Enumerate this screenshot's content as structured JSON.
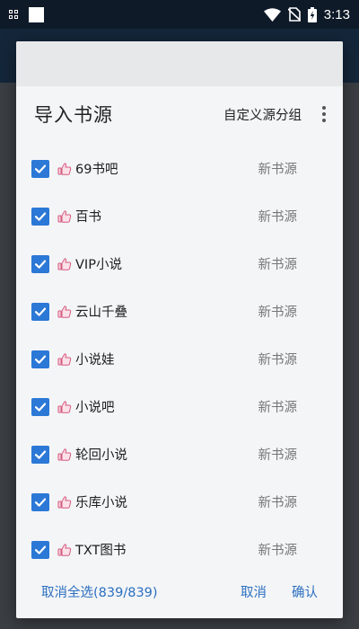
{
  "status_bar": {
    "time": "3:13"
  },
  "dialog": {
    "title": "导入书源",
    "header_action": "自定义源分组",
    "items": [
      {
        "name": "69书吧",
        "group": "新书源",
        "checked": true
      },
      {
        "name": "百书",
        "group": "新书源",
        "checked": true
      },
      {
        "name": "VIP小说",
        "group": "新书源",
        "checked": true
      },
      {
        "name": "云山千叠",
        "group": "新书源",
        "checked": true
      },
      {
        "name": "小说娃",
        "group": "新书源",
        "checked": true
      },
      {
        "name": "小说吧",
        "group": "新书源",
        "checked": true
      },
      {
        "name": "轮回小说",
        "group": "新书源",
        "checked": true
      },
      {
        "name": "乐库小说",
        "group": "新书源",
        "checked": true
      },
      {
        "name": "TXT图书",
        "group": "新书源",
        "checked": true
      }
    ],
    "footer": {
      "select_all": "取消全选(839/839)",
      "cancel": "取消",
      "confirm": "确认"
    }
  },
  "colors": {
    "checkbox": "#2b78d6",
    "footer_button": "#2b6fc0",
    "status_bar": "#0f1a28"
  }
}
